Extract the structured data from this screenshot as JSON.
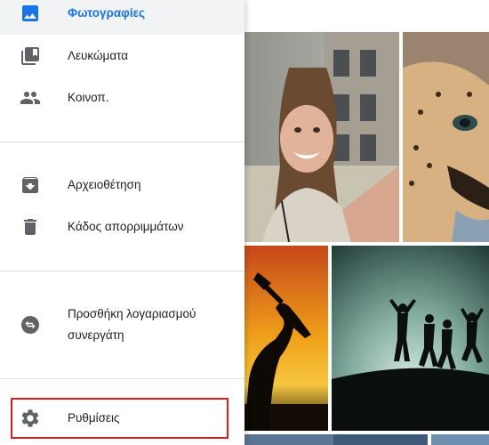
{
  "drawer": {
    "items": [
      {
        "id": "photos",
        "label": "Φωτογραφίες",
        "icon": "photo-icon",
        "active": true
      },
      {
        "id": "albums",
        "label": "Λευκώματα",
        "icon": "album-library-icon",
        "active": false
      },
      {
        "id": "sharing",
        "label": "Κοινοπ.",
        "icon": "people-icon",
        "active": false
      },
      {
        "id": "archive",
        "label": "Αρχειοθέτηση",
        "icon": "archive-icon",
        "active": false
      },
      {
        "id": "trash",
        "label": "Κάδος απορριμμάτων",
        "icon": "trash-icon",
        "active": false
      },
      {
        "id": "partner",
        "label": "Προσθήκη λογαριασμού συνεργάτη",
        "icon": "partner-swap-icon",
        "active": false
      },
      {
        "id": "settings",
        "label": "Ρυθμίσεις",
        "icon": "gear-icon",
        "active": false,
        "highlighted": true
      }
    ]
  },
  "colors": {
    "accent": "#1a73e8",
    "icon": "#5f6368",
    "text": "#202124",
    "divider": "#dadce0",
    "active_bg": "#f1f3f4",
    "highlight": "#e01b1b"
  },
  "photos": [
    {
      "name": "woman-selfie-photo"
    },
    {
      "name": "cheetah-photo"
    },
    {
      "name": "trumpet-silhouette-photo"
    },
    {
      "name": "jumping-people-silhouette-photo"
    },
    {
      "name": "bottom-photo-1"
    },
    {
      "name": "bottom-photo-2"
    }
  ]
}
